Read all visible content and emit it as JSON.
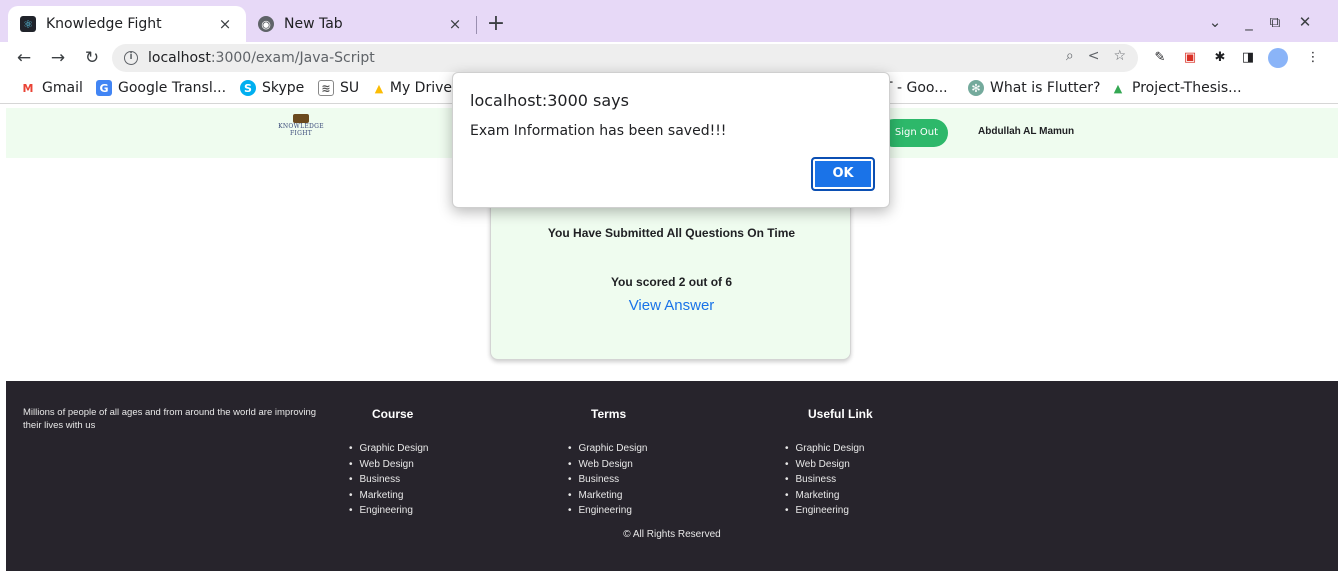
{
  "browser": {
    "tabs": [
      {
        "title": "Knowledge Fight",
        "active": true
      },
      {
        "title": "New Tab",
        "active": false
      }
    ],
    "tab_close_glyph": "×",
    "new_tab_glyph": "+",
    "url_host": "localhost",
    "url_path": ":3000/exam/Java-Script",
    "bookmarks": [
      {
        "label": "Gmail",
        "icon": "gmail-icon"
      },
      {
        "label": "Google Transl...",
        "icon": "google-translate-icon"
      },
      {
        "label": "Skype",
        "icon": "skype-icon"
      },
      {
        "label": "SU",
        "icon": "su-icon"
      },
      {
        "label": "My Drive",
        "icon": "drive-icon"
      },
      {
        "label": "T - Goo...",
        "icon": "google-docs-icon"
      },
      {
        "label": "What is Flutter?",
        "icon": "chatgpt-icon"
      },
      {
        "label": "Project-Thesis...",
        "icon": "drive-icon"
      }
    ]
  },
  "header": {
    "logo_text_line1": "KNOWLEDGE",
    "logo_text_line2": "FIGHT",
    "sign_out_label": "Sign Out",
    "user_name": "Abdullah AL Mamun"
  },
  "result": {
    "submitted_text": "You Have Submitted All Questions On Time",
    "score_text": "You scored 2 out of 6",
    "score": 2,
    "total": 6,
    "view_answer_label": "View Answer"
  },
  "alert": {
    "title": "localhost:3000 says",
    "message": "Exam Information has been saved!!!",
    "ok_label": "OK"
  },
  "footer": {
    "about": "Millions of people of all ages and from around the world are improving their lives with us",
    "columns": [
      {
        "heading": "Course",
        "items": [
          "Graphic Design",
          "Web Design",
          "Business",
          "Marketing",
          "Engineering"
        ]
      },
      {
        "heading": "Terms",
        "items": [
          "Graphic Design",
          "Web Design",
          "Business",
          "Marketing",
          "Engineering"
        ]
      },
      {
        "heading": "Useful Link",
        "items": [
          "Graphic Design",
          "Web Design",
          "Business",
          "Marketing",
          "Engineering"
        ]
      }
    ],
    "copyright": "© All Rights Reserved"
  },
  "colors": {
    "tabstrip": "#e7d9f7",
    "header_bg": "#effcef",
    "sign_out": "#2db86a",
    "link": "#1a73e8",
    "footer_bg": "#27242c"
  }
}
